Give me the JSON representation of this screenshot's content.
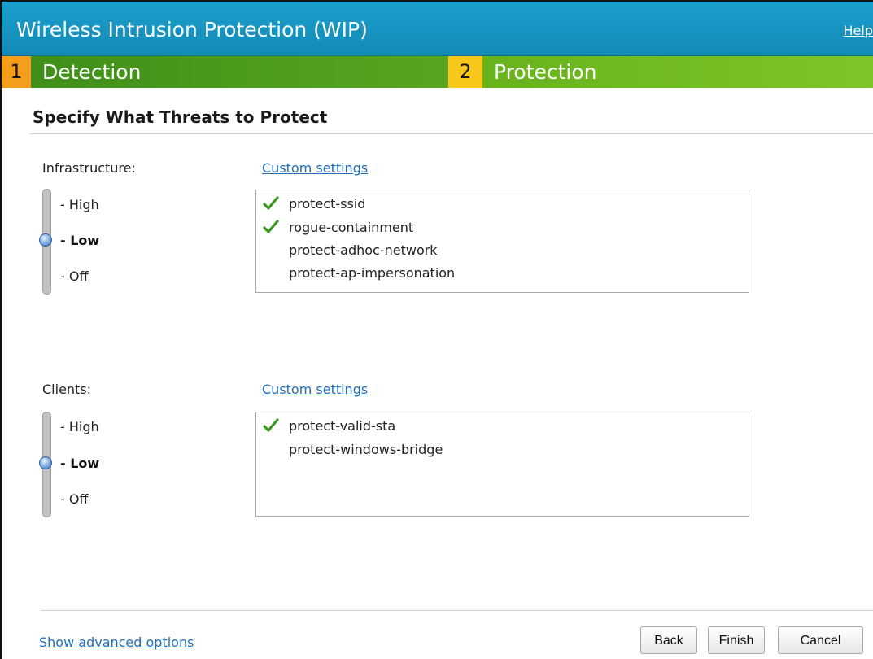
{
  "header": {
    "title": "Wireless Intrusion Protection (WIP)",
    "help_link": "Help"
  },
  "steps": [
    {
      "number": "1",
      "label": "Detection"
    },
    {
      "number": "2",
      "label": "Protection"
    }
  ],
  "section_title": "Specify What Threats to Protect",
  "infrastructure": {
    "label": "Infrastructure:",
    "custom_link": "Custom settings",
    "levels": [
      "- High",
      "- Low",
      "- Off"
    ],
    "selected_level": "Low",
    "items": [
      {
        "name": "protect-ssid",
        "checked": true
      },
      {
        "name": "rogue-containment",
        "checked": true
      },
      {
        "name": "protect-adhoc-network",
        "checked": false
      },
      {
        "name": "protect-ap-impersonation",
        "checked": false
      }
    ]
  },
  "clients": {
    "label": "Clients:",
    "custom_link": "Custom settings",
    "levels": [
      "- High",
      "- Low",
      "- Off"
    ],
    "selected_level": "Low",
    "items": [
      {
        "name": "protect-valid-sta",
        "checked": true
      },
      {
        "name": "protect-windows-bridge",
        "checked": false
      }
    ]
  },
  "footer": {
    "advanced_link": "Show advanced options",
    "back_label": "Back",
    "finish_label": "Finish",
    "cancel_label": "Cancel"
  },
  "colors": {
    "header_bg": "#1b9fcc",
    "step_active_bg": "#7cc52a",
    "step_done_bg": "#3f8f1a",
    "step_num_1": "#f59d1c",
    "step_num_2": "#f7c81a",
    "link": "#1f6fb8",
    "check": "#3a9a1e"
  }
}
